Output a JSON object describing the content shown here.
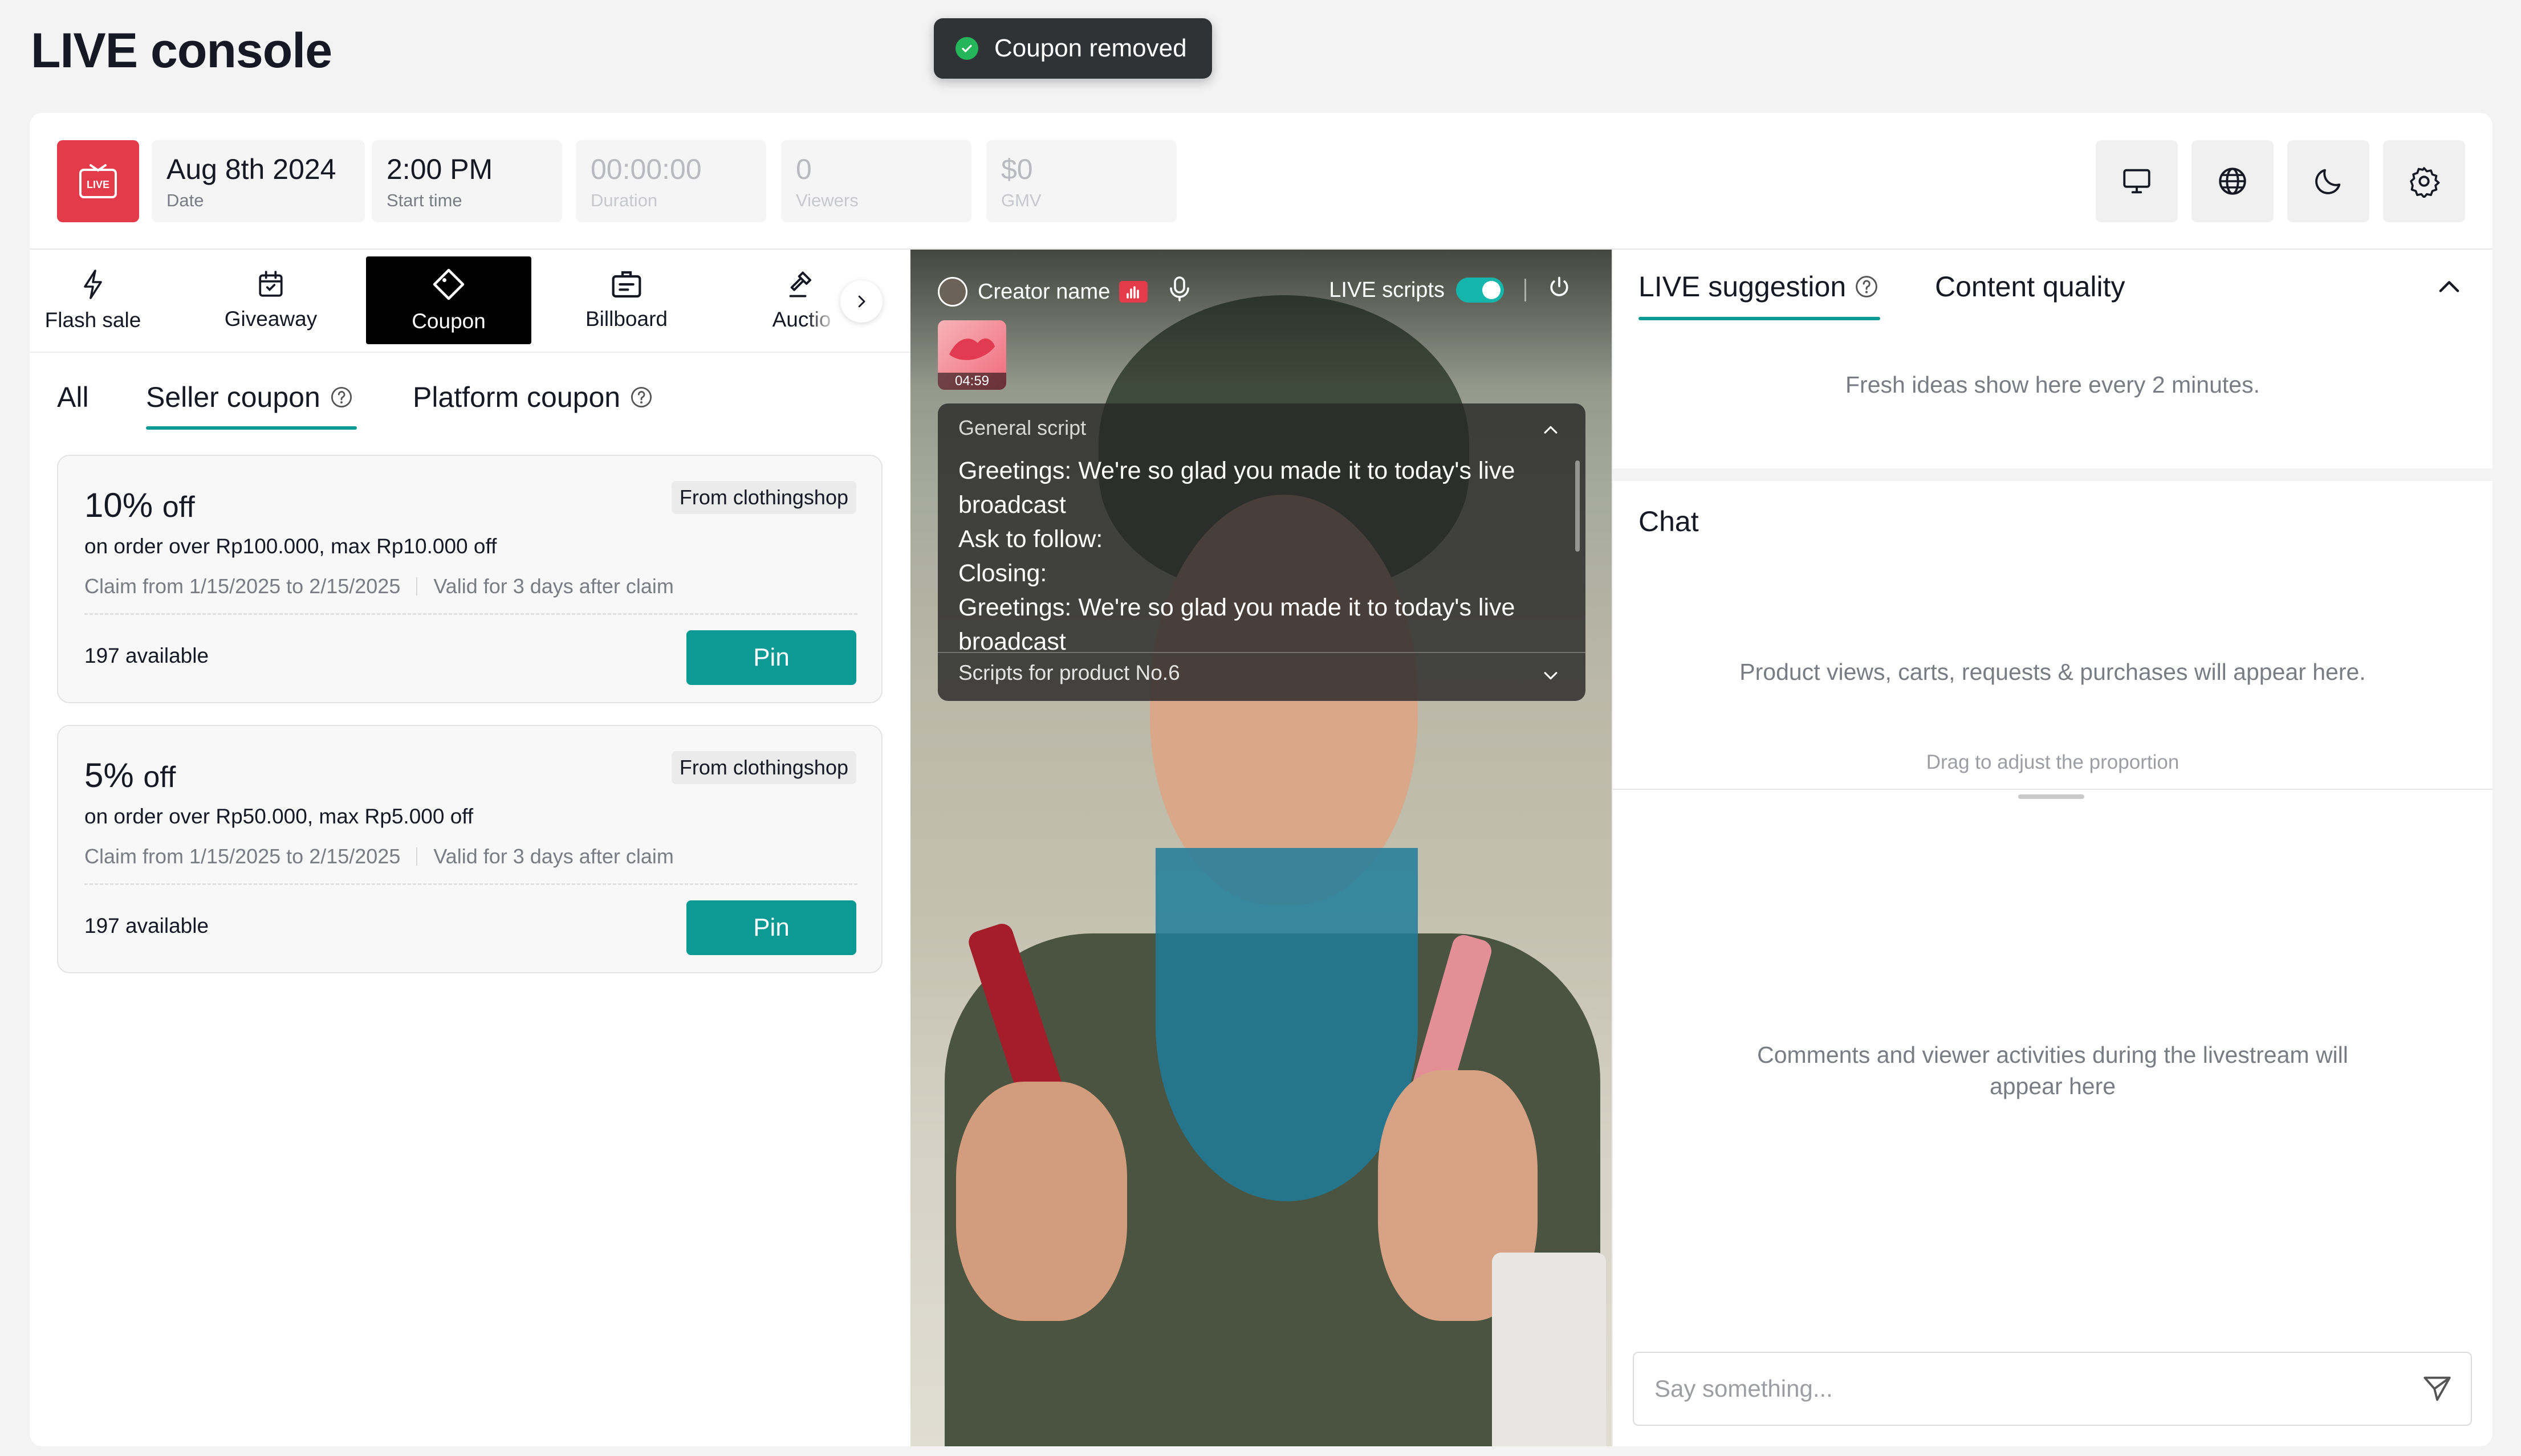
{
  "page": {
    "title": "LIVE console"
  },
  "toast": {
    "text": "Coupon removed",
    "icon": "check-circle-icon"
  },
  "stats": {
    "live_badge": "LIVE",
    "date": {
      "value": "Aug 8th 2024",
      "label": "Date"
    },
    "start_time": {
      "value": "2:00 PM",
      "label": "Start time"
    },
    "duration": {
      "value": "00:00:00",
      "label": "Duration"
    },
    "viewers": {
      "value": "0",
      "label": "Viewers"
    },
    "gmv": {
      "value": "$0",
      "label": "GMV"
    }
  },
  "toolbar_icons": [
    "monitor-icon",
    "globe-icon",
    "moon-icon",
    "gear-icon"
  ],
  "tools": {
    "tabs": [
      {
        "label": "Flash sale",
        "icon": "lightning-icon"
      },
      {
        "label": "Giveaway",
        "icon": "calendar-gift-icon"
      },
      {
        "label": "Coupon",
        "icon": "coupon-diamond-icon",
        "active": true
      },
      {
        "label": "Billboard",
        "icon": "billboard-icon"
      },
      {
        "label": "Auctio",
        "icon": "gavel-icon"
      }
    ]
  },
  "coupon_tabs": {
    "all": "All",
    "seller": "Seller coupon",
    "platform": "Platform coupon",
    "active": "seller"
  },
  "coupons": [
    {
      "amount": "10%",
      "unit": "off",
      "source": "From clothingshop",
      "condition": "on order over Rp100.000, max Rp10.000 off",
      "claim_range": "Claim from 1/15/2025 to 2/15/2025",
      "validity": "Valid for 3 days after claim",
      "available": "197 available",
      "pin_label": "Pin"
    },
    {
      "amount": "5%",
      "unit": "off",
      "source": "From clothingshop",
      "condition": "on order over Rp50.000, max Rp5.000 off",
      "claim_range": "Claim from 1/15/2025 to 2/15/2025",
      "validity": "Valid for 3 days after claim",
      "available": "197 available",
      "pin_label": "Pin"
    }
  ],
  "video": {
    "creator_name": "Creator name",
    "live_scripts_label": "LIVE scripts",
    "live_scripts_on": true,
    "thumb_time": "04:59",
    "script_panel": {
      "header": "General script",
      "lines": [
        "Greetings: We're so glad you made it to today's live",
        "broadcast",
        "Ask to follow:",
        "Closing:",
        "Greetings: We're so glad you made it to today's live",
        "broadcast"
      ],
      "footer": "Scripts for product No.6"
    }
  },
  "right": {
    "tabs": {
      "suggestion": "LIVE suggestion",
      "quality": "Content quality"
    },
    "suggestion_hint": "Fresh ideas show here every 2 minutes.",
    "chat_title": "Chat",
    "chat_activity_hint": "Product views, carts, requests & purchases will appear here.",
    "drag_hint": "Drag to adjust the proportion",
    "comments_hint_line1": "Comments and viewer activities during the livestream will",
    "comments_hint_line2": "appear here",
    "input_placeholder": "Say something..."
  },
  "colors": {
    "accent": "#0d9a95",
    "live_red": "#e33b4a",
    "toast_bg": "#2f3336"
  }
}
